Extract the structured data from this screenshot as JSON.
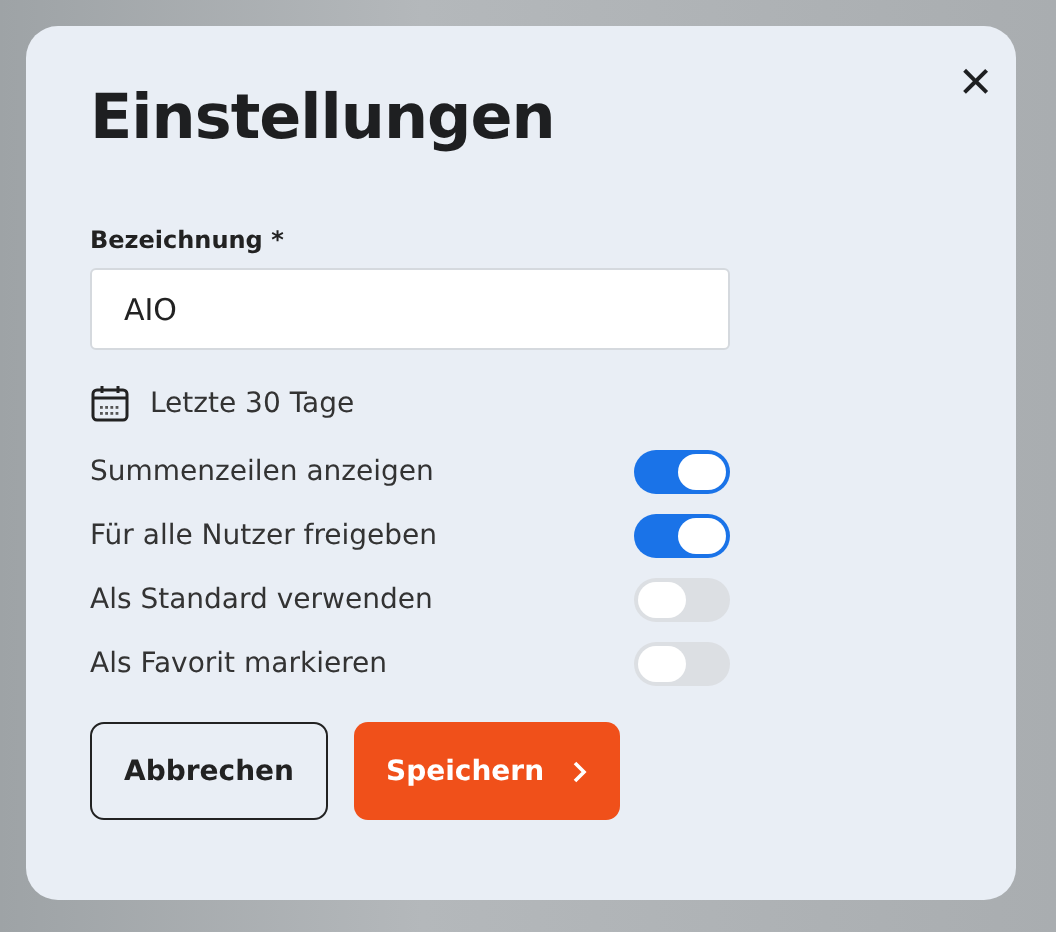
{
  "dialog": {
    "title": "Einstellungen",
    "close": "×"
  },
  "name_field": {
    "label": "Bezeichnung *",
    "value": "AIO"
  },
  "date_range": {
    "label": "Letzte 30 Tage"
  },
  "toggles": [
    {
      "label": "Summenzeilen anzeigen",
      "on": true
    },
    {
      "label": "Für alle Nutzer freigeben",
      "on": true
    },
    {
      "label": "Als Standard verwenden",
      "on": false
    },
    {
      "label": "Als Favorit markieren",
      "on": false
    }
  ],
  "buttons": [
    {
      "label": "Abbrechen",
      "kind": "secondary"
    },
    {
      "label": "Speichern",
      "kind": "primary"
    }
  ]
}
